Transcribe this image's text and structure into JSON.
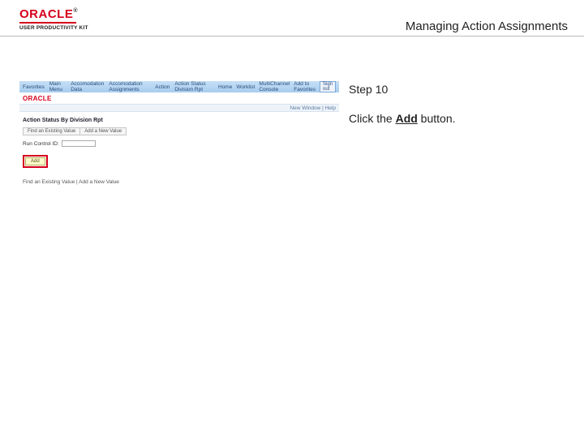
{
  "header": {
    "brand": "ORACLE",
    "tm": "®",
    "upk": "USER PRODUCTIVITY KIT",
    "title": "Managing Action Assignments"
  },
  "instructions": {
    "step_label": "Step 10",
    "line_prefix": "Click the ",
    "bold_word": "Add",
    "line_suffix": " button."
  },
  "app": {
    "nav": {
      "favorites": "Favorites",
      "main": "Main Menu",
      "crumb1": "Accomodation Data",
      "crumb2": "Accomodation Assignments",
      "crumb3": "Action",
      "crumb4": "Action Status Division Rpt",
      "home": "Home",
      "worklist": "Worklist",
      "muli": "MultiChannel Console",
      "addfav": "Add to Favorites",
      "signout": "Sign out"
    },
    "brandbar": {
      "logo": "ORACLE",
      "sub": "New Window | Help"
    },
    "report_title": "Action Status By Division Rpt",
    "tabs": {
      "a": "Find an Existing Value",
      "b": "Add a New Value"
    },
    "find": {
      "label": "Run Control ID:"
    },
    "add_label": "Add",
    "finder": "Find an Existing Value | Add a New Value"
  }
}
